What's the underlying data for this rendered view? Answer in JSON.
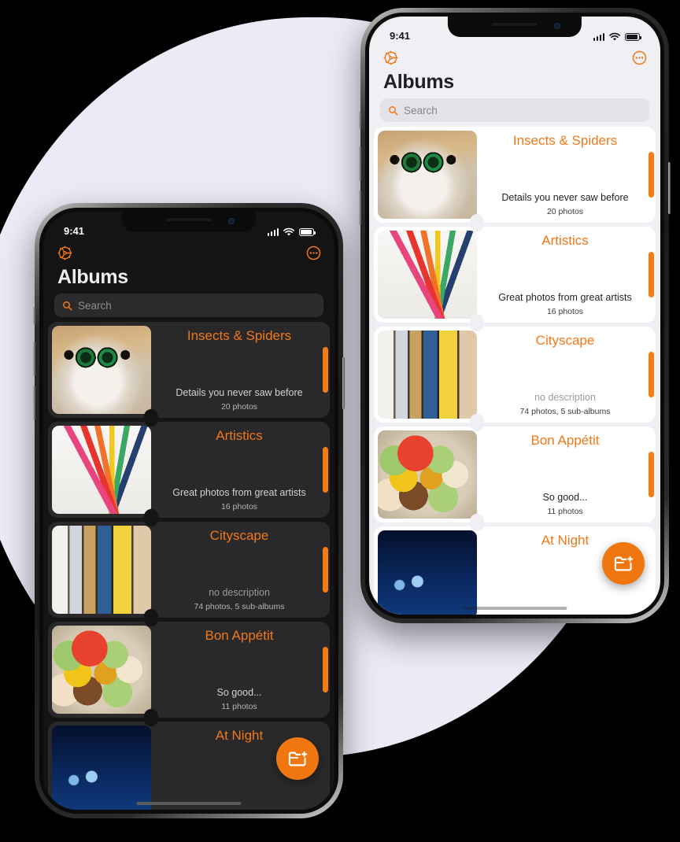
{
  "theme": {
    "accent": "#F07818",
    "accent_fab": "#F0760F",
    "backdrop": "#ECEAF6",
    "dark_bg": "#141414",
    "dark_card": "#29292B",
    "light_bg": "#EFEFF4",
    "light_card": "#FFFFFF"
  },
  "status_bar": {
    "time": "9:41",
    "cellular_icon": "signal-bars-icon",
    "wifi_icon": "wifi-icon",
    "battery_icon": "battery-icon"
  },
  "nav": {
    "settings_icon": "gear-icon",
    "more_icon": "more-circle-icon"
  },
  "header": {
    "title": "Albums"
  },
  "search": {
    "placeholder": "Search",
    "value": "",
    "icon": "search-icon"
  },
  "fab": {
    "icon": "new-folder-icon",
    "label": ""
  },
  "albums": [
    {
      "title": "Insects & Spiders",
      "description": "Details you never saw before",
      "count": "20 photos",
      "thumb": "spider-macro-photo",
      "no_description": false
    },
    {
      "title": "Artistics",
      "description": "Great photos from great artists",
      "count": "16 photos",
      "thumb": "colored-pencils-photo",
      "no_description": false
    },
    {
      "title": "Cityscape",
      "description": "no description",
      "count": "74 photos, 5 sub-albums",
      "thumb": "half-timbered-houses-photo",
      "no_description": true
    },
    {
      "title": "Bon Appétit",
      "description": "So good...",
      "count": "11 photos",
      "thumb": "macarons-photo",
      "no_description": false
    },
    {
      "title": "At Night",
      "description": "",
      "count": "",
      "thumb": "night-city-photo",
      "no_description": false
    }
  ]
}
